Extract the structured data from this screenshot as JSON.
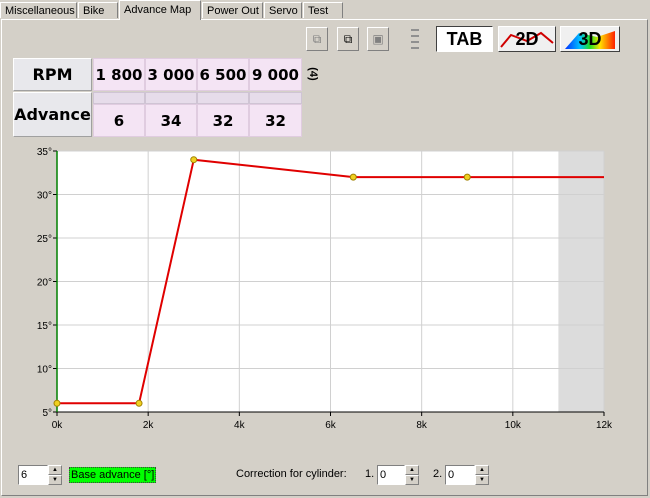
{
  "tabs": [
    "Miscellaneous",
    "Bike",
    "Advance Map",
    "Power Out",
    "Servo",
    "Test"
  ],
  "active_tab": "Advance Map",
  "toolbar": {
    "tab_label": "TAB",
    "view2d_label": "2D",
    "view3d_label": "3D"
  },
  "table": {
    "rpm_label": "RPM",
    "advance_label": "Advance",
    "rpm_values": [
      "1 800",
      "3 000",
      "6 500",
      "9 000"
    ],
    "advance_values": [
      "6",
      "34",
      "32",
      "32"
    ],
    "count_label": "(4)"
  },
  "chart_data": {
    "type": "line",
    "x": [
      0,
      1800,
      3000,
      6500,
      9000,
      12000
    ],
    "y": [
      6,
      6,
      34,
      32,
      32,
      32
    ],
    "points": [
      [
        0,
        6
      ],
      [
        1800,
        6
      ],
      [
        3000,
        34
      ],
      [
        6500,
        32
      ],
      [
        9000,
        32
      ]
    ],
    "xlim": [
      0,
      12000
    ],
    "ylim": [
      5,
      35
    ],
    "xticks": [
      "0k",
      "2k",
      "4k",
      "6k",
      "8k",
      "10k",
      "12k"
    ],
    "yticks": [
      "5°",
      "10°",
      "15°",
      "20°",
      "25°",
      "30°",
      "35°"
    ],
    "shaded_from": 11000,
    "grid": true,
    "line_color": "#e00000",
    "point_color": "#f0d020"
  },
  "bottom": {
    "base_value": "6",
    "base_label": "Base advance [°]",
    "correction_label": "Correction for cylinder:",
    "cyl1_label": "1.",
    "cyl1_value": "0",
    "cyl2_label": "2.",
    "cyl2_value": "0"
  }
}
